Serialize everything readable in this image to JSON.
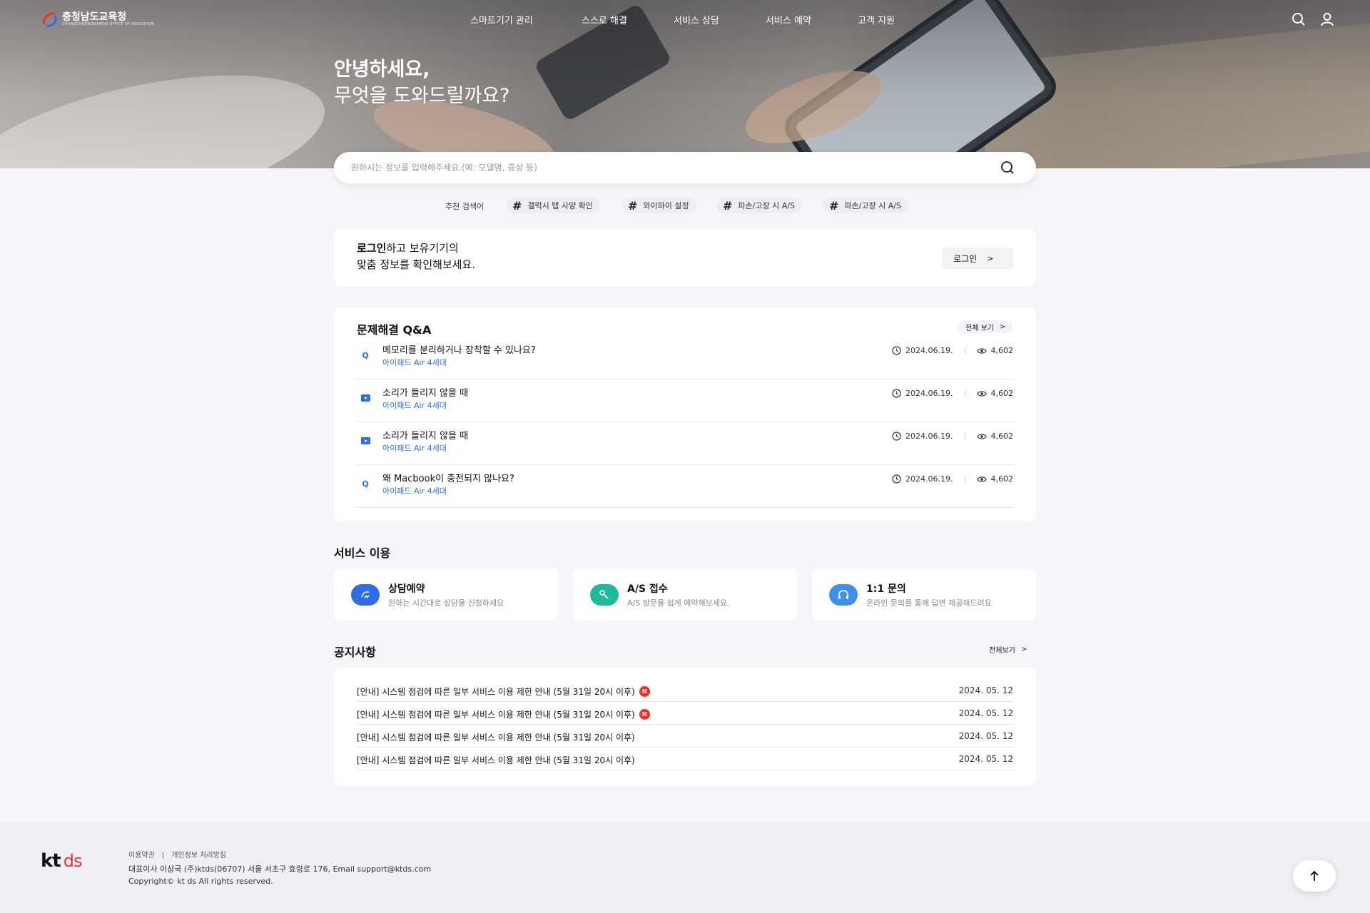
{
  "header": {
    "logo_name": "충청남도교육청",
    "logo_sub": "CHUNGCHEONGNAMDO OFFICE OF EDUCATION",
    "nav": [
      "스마트기기 관리",
      "스스로 해결",
      "서비스 상담",
      "서비스 예약",
      "고객 지원"
    ],
    "icons": [
      "search-icon",
      "user-icon"
    ]
  },
  "hero": {
    "greeting_line1": "안녕하세요,",
    "greeting_line2": "무엇을 도와드릴까요?"
  },
  "search": {
    "placeholder": "원하시는 정보를 입력해주세요.(예: 모델명, 증상 등)",
    "value": ""
  },
  "recommended": {
    "label": "추천 검색어",
    "tags": [
      "갤럭시 탭 사양 확인",
      "와이파이 설정",
      "파손/고장 시 A/S",
      "파손/고장 시 A/S"
    ]
  },
  "login_card": {
    "line1_bold": "로그인",
    "line1_rest": "하고 보유기기의",
    "line2": "맞춤 정보를 확인해보세요.",
    "button": "로그인"
  },
  "qa": {
    "title": "문제해결 Q&A",
    "view_all": "전체 보기",
    "items": [
      {
        "type": "Q",
        "question": "메모리를 분리하거나 장착할 수 있나요?",
        "device": "아이패드 Air 4세대",
        "date": "2024.06.19.",
        "views": "4,602"
      },
      {
        "type": "video",
        "question": "소리가 들리지 않을 때",
        "device": "아이패드 Air 4세대",
        "date": "2024.06.19.",
        "views": "4,602"
      },
      {
        "type": "video",
        "question": "소리가 들리지 않을 때",
        "device": "아이패드 Air 4세대",
        "date": "2024.06.19.",
        "views": "4,602"
      },
      {
        "type": "Q",
        "question": "왜 Macbook이 충전되지 않나요?",
        "device": "아이패드 Air 4세대",
        "date": "2024.06.19.",
        "views": "4,602"
      }
    ]
  },
  "services": {
    "title": "서비스 이용",
    "items": [
      {
        "icon": "consult-icon",
        "title": "상담예약",
        "desc": "원하는 시간대로 상담을 신청하세요",
        "color": "#2e6ee6"
      },
      {
        "icon": "wrench-icon",
        "title": "A/S 접수",
        "desc": "A/S 방문을 쉽게 예약해보세요.",
        "color": "#1fb99b"
      },
      {
        "icon": "headset-icon",
        "title": "1:1 문의",
        "desc": "온라인 문의를 통해 답변 제공해드려요",
        "color": "#3f8ff0"
      }
    ]
  },
  "notices": {
    "title": "공지사항",
    "view_all": "전체보기",
    "new_badge": "N",
    "items": [
      {
        "text": "[안내] 시스템 점검에 따른 일부 서비스 이용 제한 안내 (5월 31일 20시 이후)",
        "is_new": true,
        "date": "2024. 05. 12"
      },
      {
        "text": "[안내] 시스템 점검에 따른 일부 서비스 이용 제한 안내 (5월 31일 20시 이후)",
        "is_new": true,
        "date": "2024. 05. 12"
      },
      {
        "text": "[안내] 시스템 점검에 따른 일부 서비스 이용 제한 안내 (5월 31일 20시 이후)",
        "is_new": false,
        "date": "2024. 05. 12"
      },
      {
        "text": "[안내] 시스템 점검에 따른 일부 서비스 이용 제한 안내 (5월 31일 20시 이후)",
        "is_new": false,
        "date": "2024. 05. 12"
      }
    ]
  },
  "footer": {
    "logo_kt": "kt",
    "logo_ds": "ds",
    "terms": "이용약관",
    "divider": "|",
    "privacy": "개인정보 처리방침",
    "address": "대표이사 이상국 (주)ktds(06707) 서울 서초구 효령로 176, Email support@ktds.com",
    "copyright": "Copyright© kt ds All rights reserved."
  },
  "colors": {
    "accent": "#2e6ee6",
    "new_badge": "#e8322a",
    "page_bg": "#f5f6f9"
  }
}
